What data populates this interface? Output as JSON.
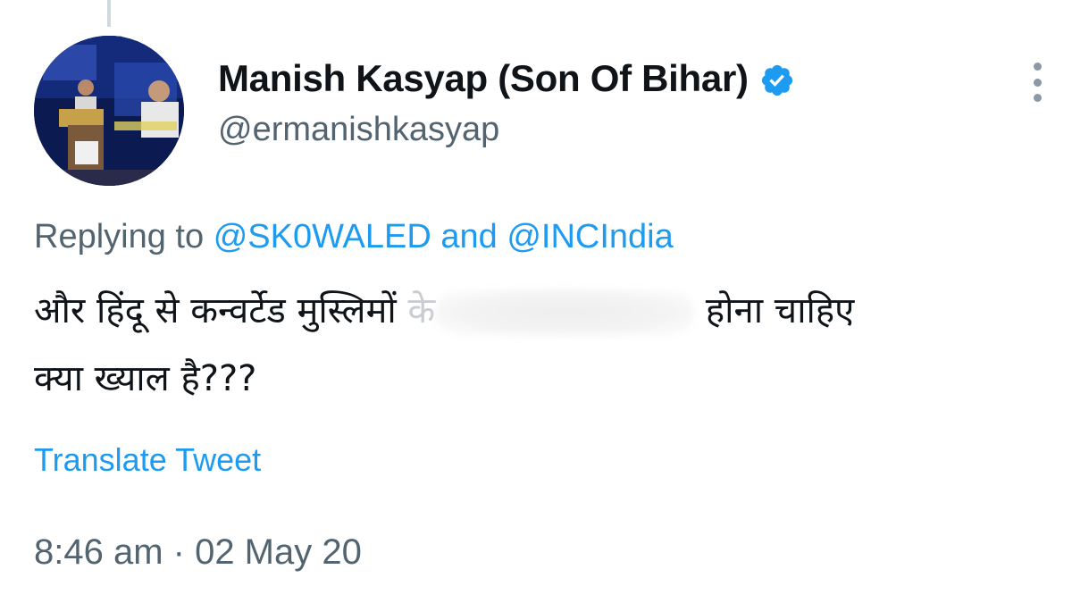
{
  "author": {
    "display_name": "Manish Kasyap (Son Of Bihar)",
    "handle": "@ermanishkasyap",
    "verified": true,
    "avatar_icon": "profile-photo"
  },
  "reply_context": {
    "prefix": "Replying to",
    "mention_1": "@SK0WALED",
    "conjunction": "and",
    "mention_2": "@INCIndia"
  },
  "tweet": {
    "line1_start": "और  हिंदू से कन्वर्टेड मुस्लिमों",
    "line1_fade": "के",
    "line1_end": "होना चाहिए",
    "line2": "क्या ख्याल है???"
  },
  "actions": {
    "translate_label": "Translate Tweet"
  },
  "timestamp": "8:46 am · 02 May 20",
  "colors": {
    "link": "#1d9bf0",
    "secondary_text": "#536471",
    "verified_badge": "#1d9bf0"
  }
}
